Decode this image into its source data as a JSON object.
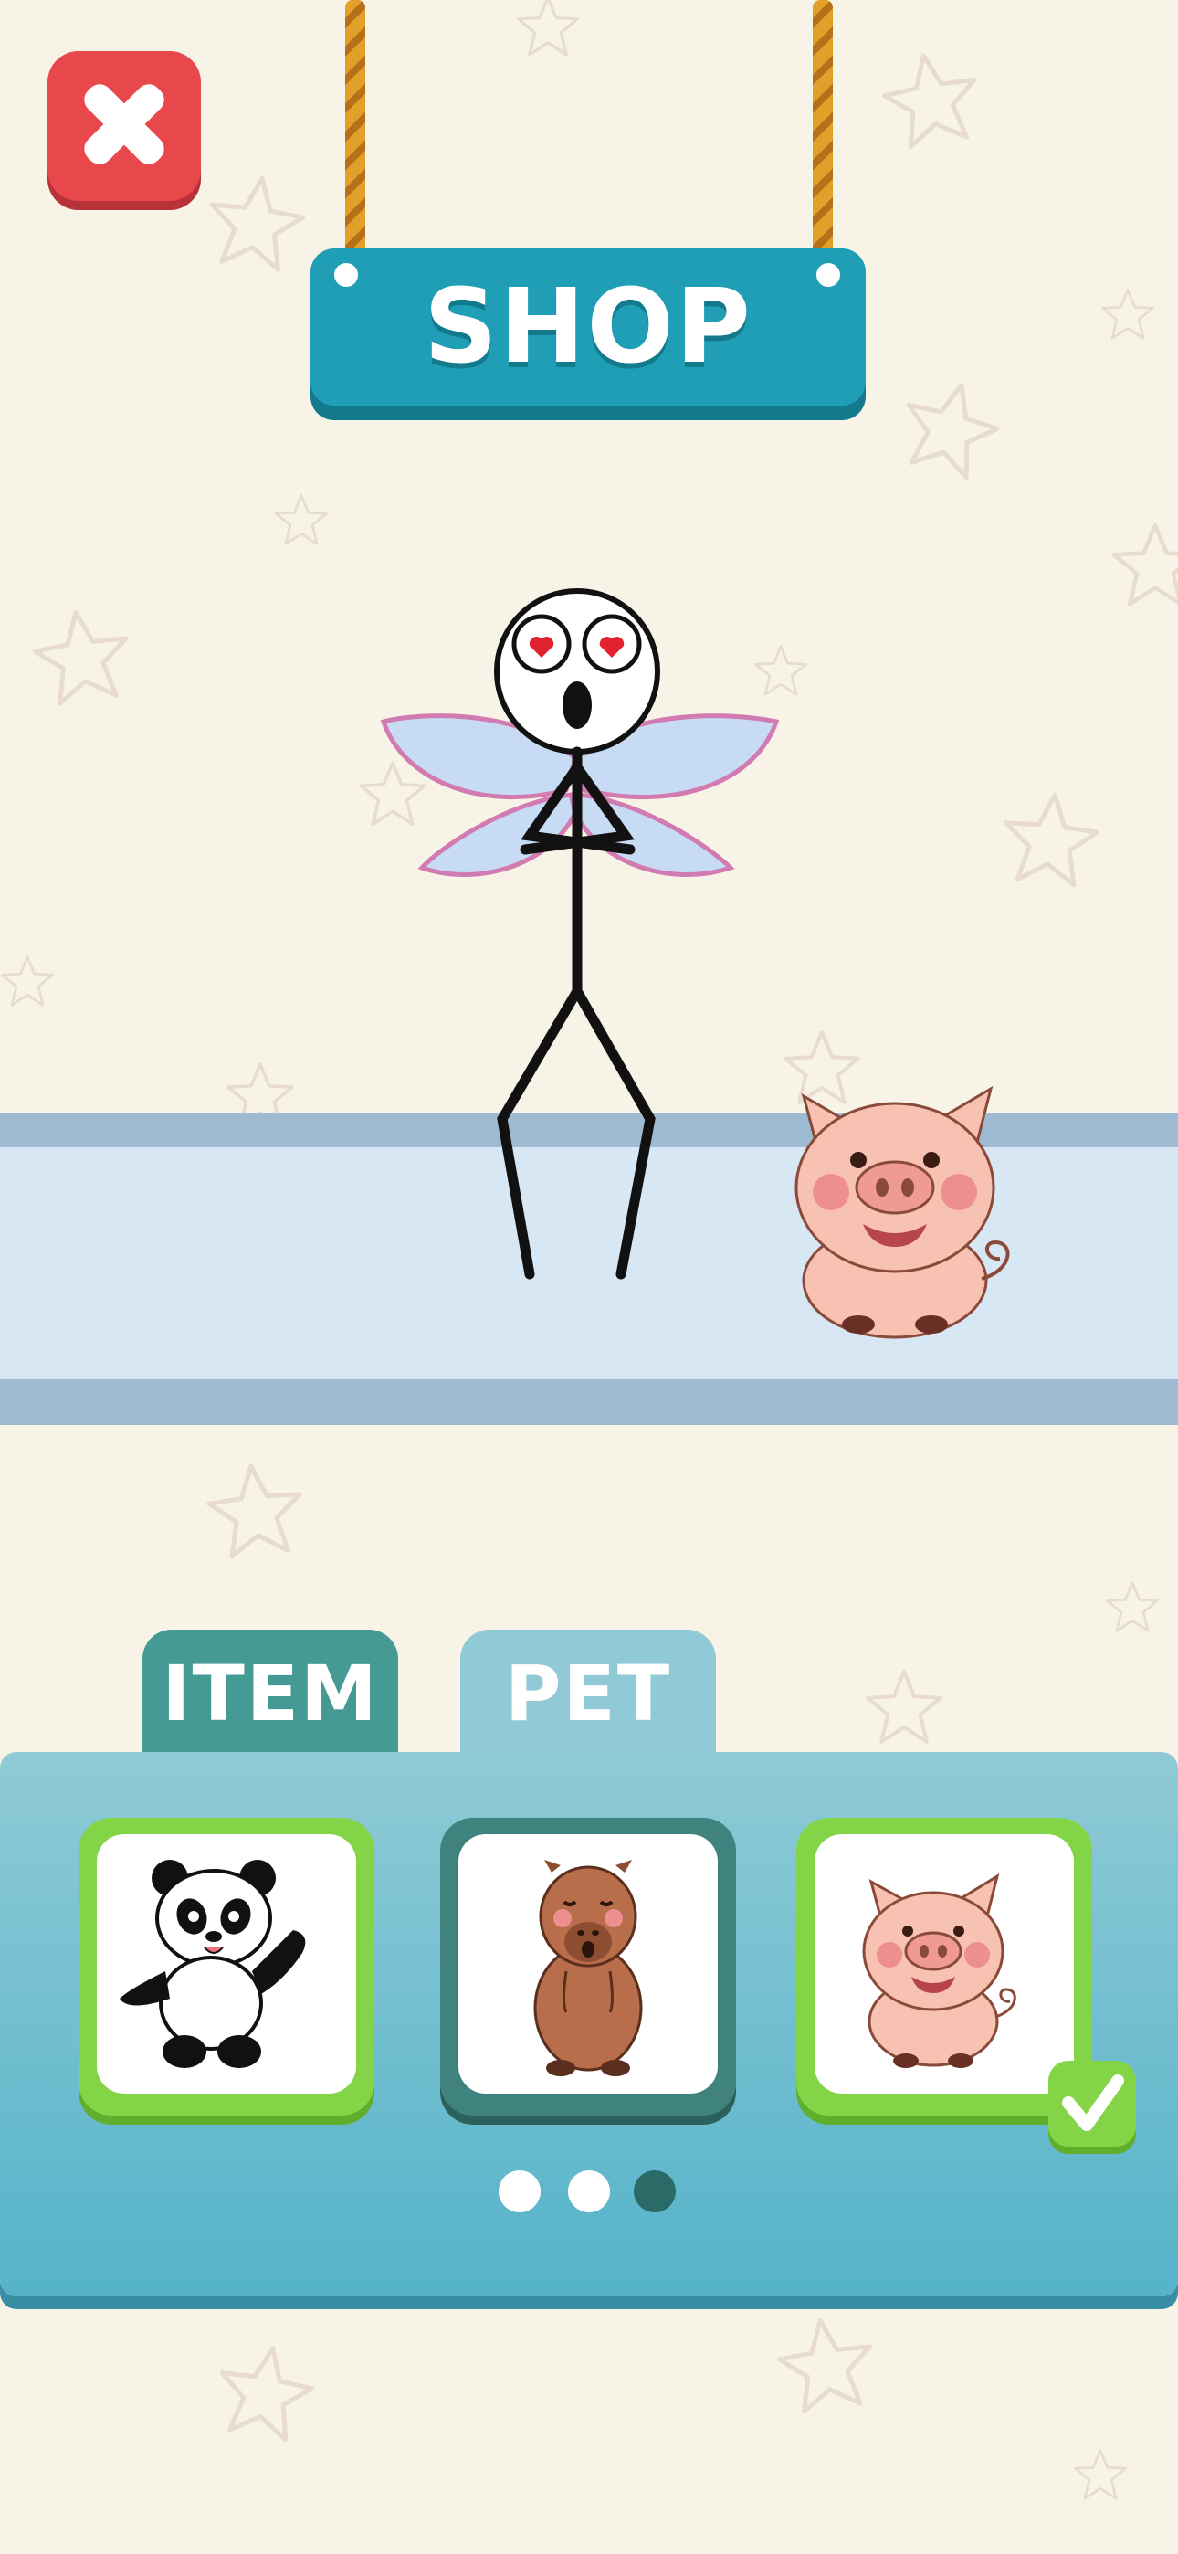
{
  "header": {
    "title": "SHOP",
    "close_icon": "close-x-icon"
  },
  "preview": {
    "character": "stickman-with-fairy-wings",
    "pet": "pig"
  },
  "tabs": [
    {
      "label": "ITEM",
      "selected": false
    },
    {
      "label": "PET",
      "selected": true
    }
  ],
  "pets": [
    {
      "name": "panda",
      "owned": true,
      "equipped": false
    },
    {
      "name": "capybara",
      "owned": false,
      "equipped": false
    },
    {
      "name": "pig",
      "owned": true,
      "equipped": true
    }
  ],
  "equipped_icon": "checkmark-icon",
  "pagination": {
    "pages": 3,
    "current": 3
  },
  "colors": {
    "background": "#f7f3e6",
    "close": "#e8474b",
    "sign": "#1f9eb5",
    "tab_item": "#459a94",
    "tab_pet": "#8fcad6",
    "owned_border": "#84d447",
    "locked_border": "#3f827e",
    "dot_inactive": "#ffffff",
    "dot_active": "#2a6b68"
  }
}
